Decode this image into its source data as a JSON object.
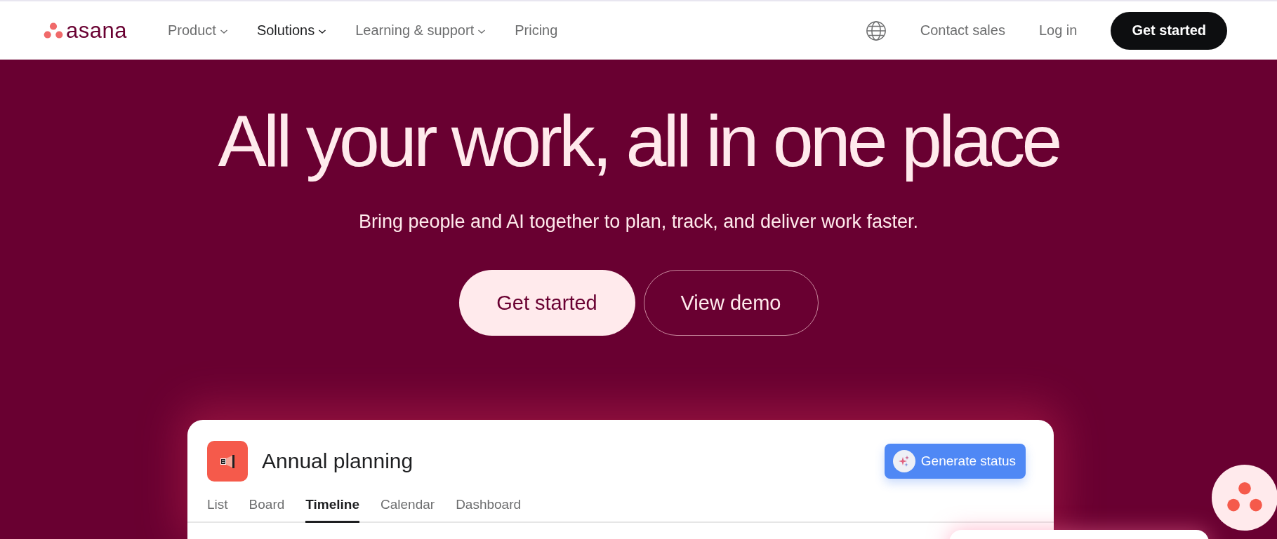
{
  "nav": {
    "logo": "asana",
    "links": [
      {
        "label": "Product",
        "dropdown": true,
        "selected": false
      },
      {
        "label": "Solutions",
        "dropdown": true,
        "selected": true
      },
      {
        "label": "Learning & support",
        "dropdown": true,
        "selected": false
      },
      {
        "label": "Pricing",
        "dropdown": false,
        "selected": false
      }
    ],
    "contact": "Contact sales",
    "login": "Log in",
    "cta": "Get started"
  },
  "hero": {
    "headline": "All your work, all in one place",
    "subtitle": "Bring people and AI together to plan, track, and deliver work faster.",
    "buttons": [
      {
        "label": "Get started",
        "kind": "primary"
      },
      {
        "label": "View demo",
        "kind": "outline"
      }
    ]
  },
  "preview": {
    "title": "Annual planning",
    "action": "Generate status",
    "tabs": [
      {
        "label": "List",
        "selected": false
      },
      {
        "label": "Board",
        "selected": false
      },
      {
        "label": "Timeline",
        "selected": true
      },
      {
        "label": "Calendar",
        "selected": false
      },
      {
        "label": "Dashboard",
        "selected": false
      }
    ]
  }
}
